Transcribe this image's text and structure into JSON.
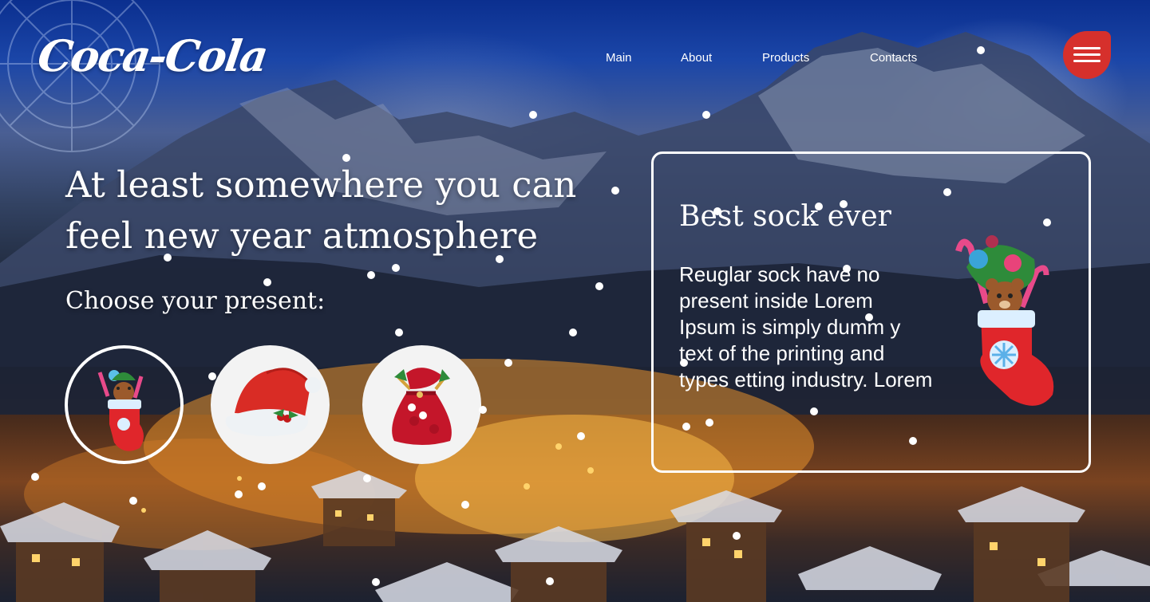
{
  "header": {
    "logo_text": "Coca-Cola",
    "nav": [
      "Main",
      "About",
      "Products",
      "Contacts"
    ],
    "menu_icon": "hamburger-icon"
  },
  "hero": {
    "title": "At least somewhere you can feel new year atmosphere",
    "subtitle": "Choose your present:"
  },
  "presents": [
    {
      "name": "sock",
      "icon": "stocking-icon",
      "selected": true
    },
    {
      "name": "hat",
      "icon": "santa-hat-icon",
      "selected": false
    },
    {
      "name": "bag",
      "icon": "gift-bag-icon",
      "selected": false
    }
  ],
  "card": {
    "title": "Best sock ever",
    "text": "Reuglar sock have no present inside Lorem Ipsum is simply dumm  y text of the printing and types etting industry. Lorem",
    "image_icon": "stocking-with-bear-icon"
  },
  "colors": {
    "accent": "#d6302c",
    "sock_red": "#e0262b",
    "text": "#ffffff"
  }
}
